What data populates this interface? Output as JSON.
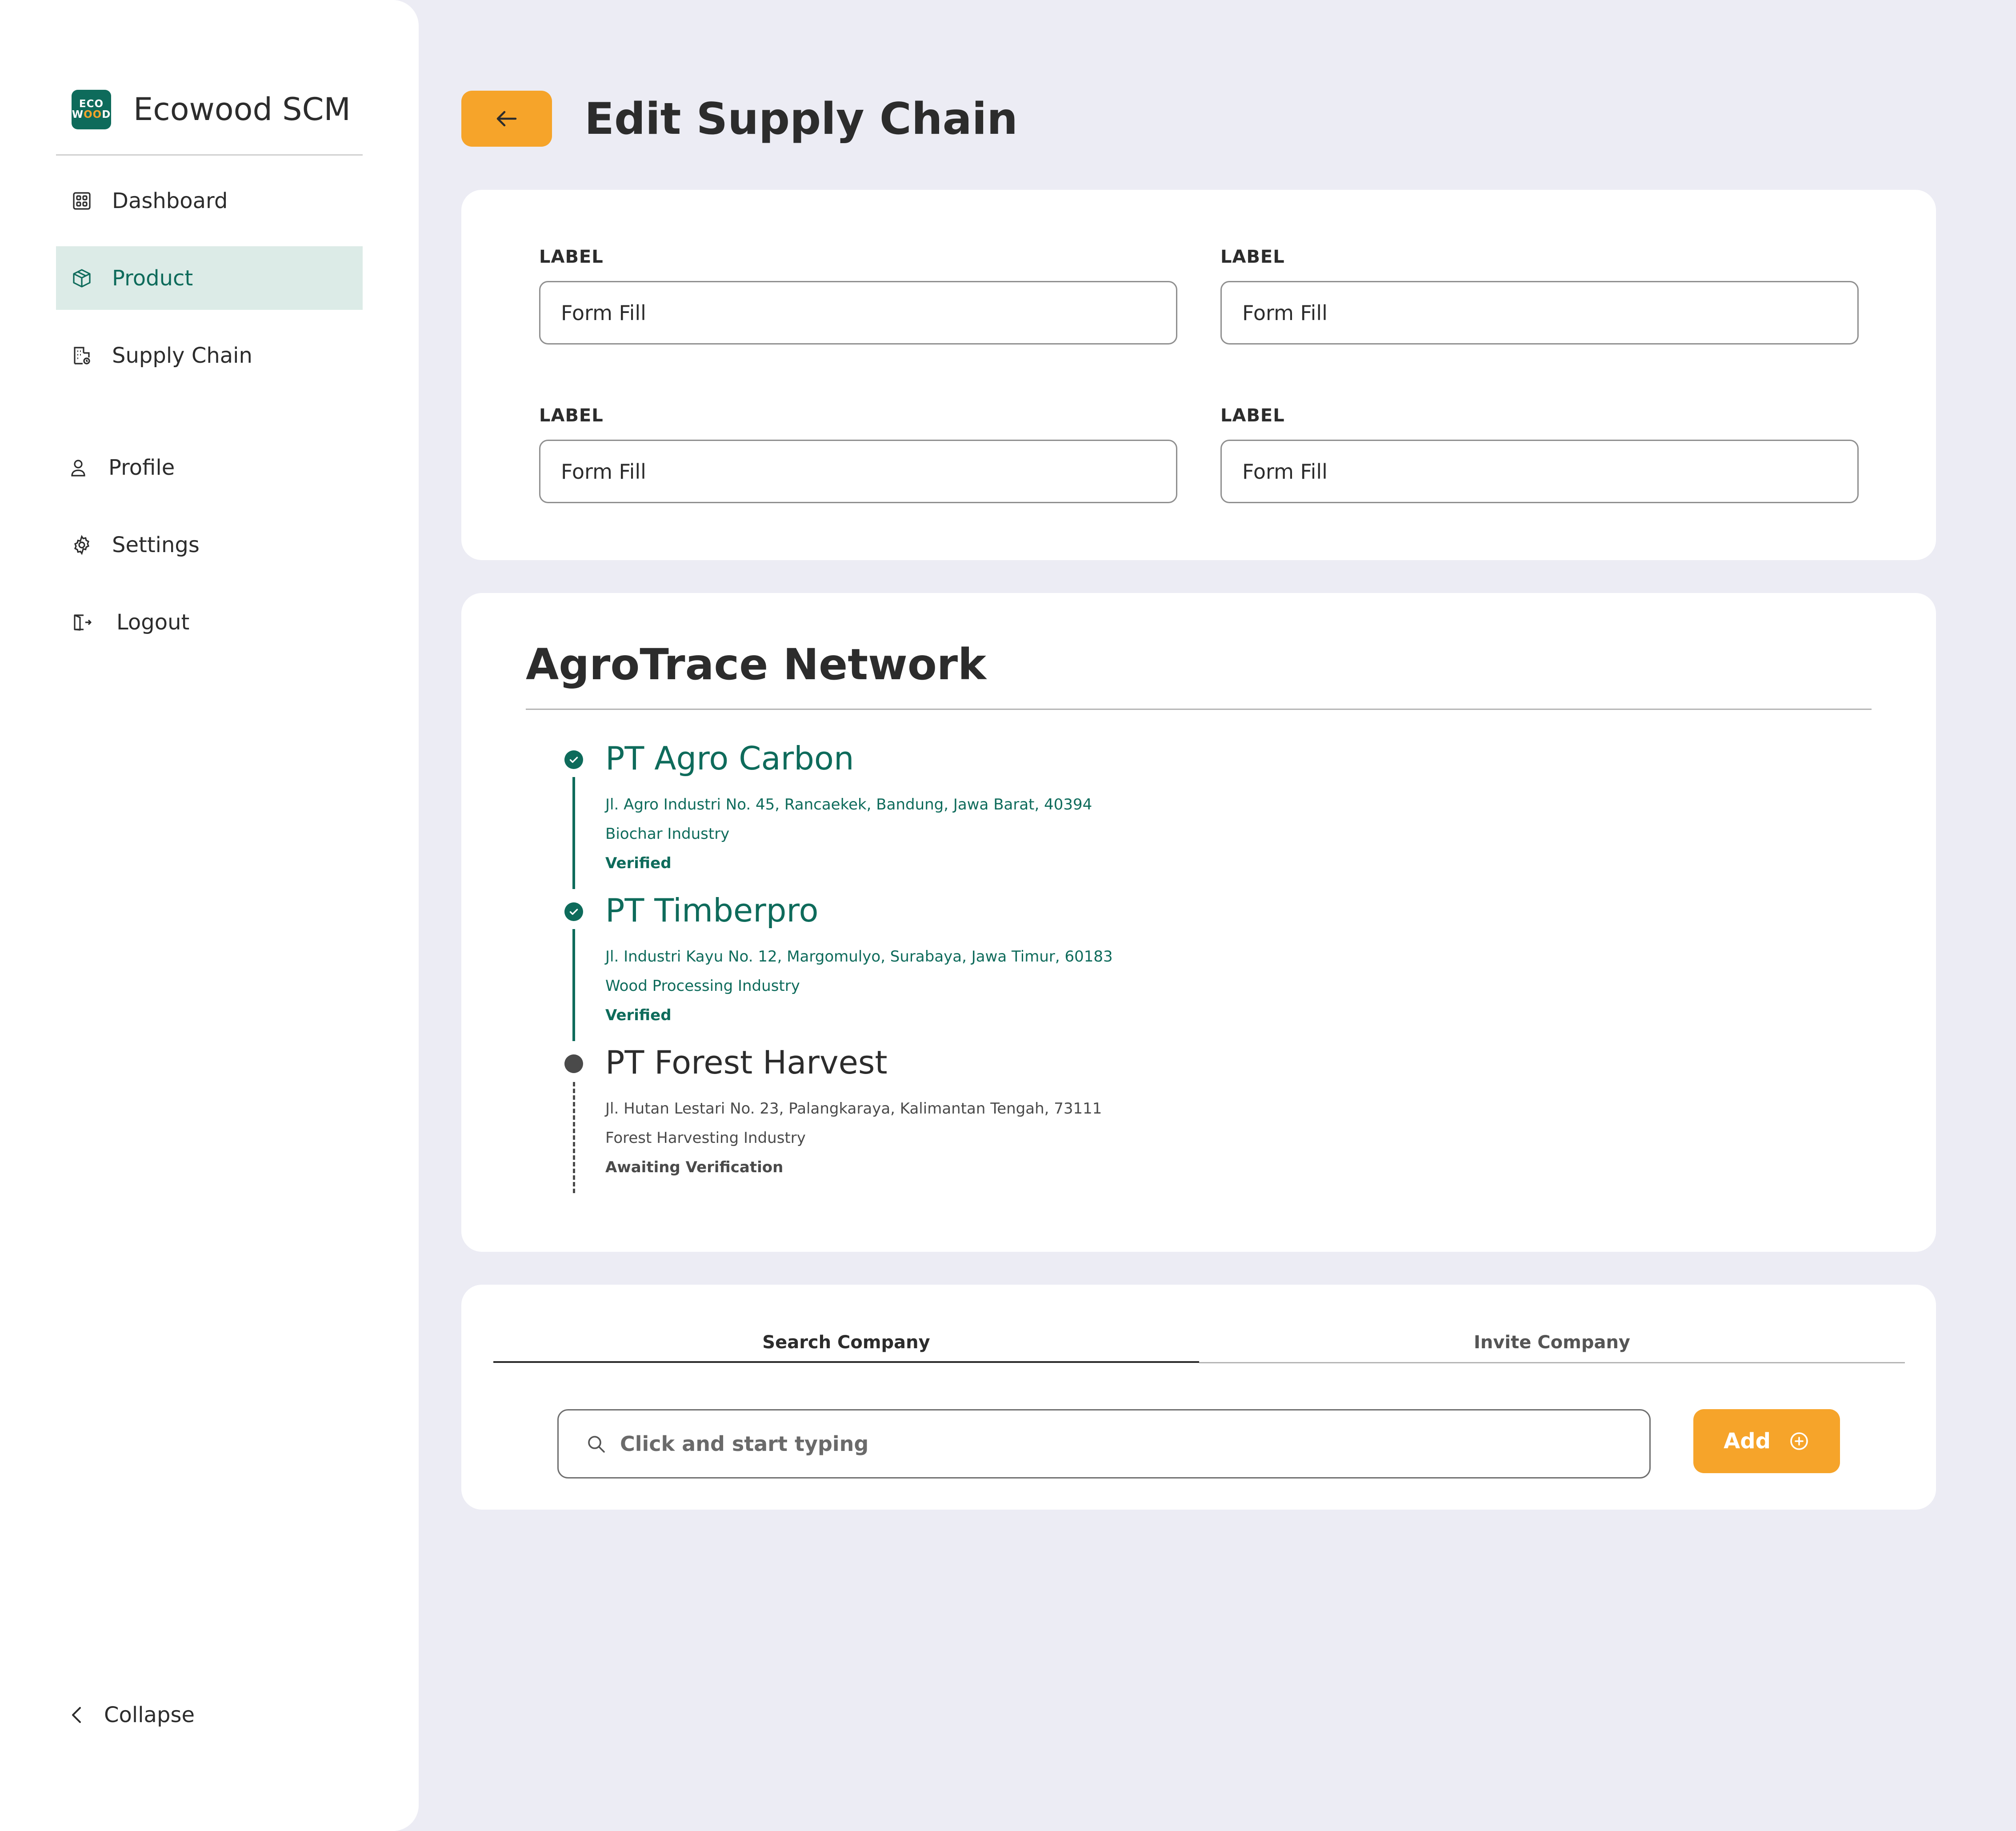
{
  "app": {
    "name": "Ecowood SCM",
    "logo_line1": "ECO",
    "logo_line2_a": "W",
    "logo_line2_b": "OO",
    "logo_line2_c": "D"
  },
  "sidebar": {
    "items": [
      {
        "label": "Dashboard",
        "icon": "grid-icon"
      },
      {
        "label": "Product",
        "icon": "box-icon",
        "active": true
      },
      {
        "label": "Supply Chain",
        "icon": "building-icon"
      },
      {
        "label": "Profile",
        "icon": "user-icon"
      },
      {
        "label": "Settings",
        "icon": "gear-icon"
      },
      {
        "label": "Logout",
        "icon": "logout-icon"
      }
    ],
    "collapse_label": "Collapse"
  },
  "header": {
    "title": "Edit Supply Chain"
  },
  "form": {
    "fields": [
      {
        "label": "LABEL",
        "value": "Form Fill"
      },
      {
        "label": "LABEL",
        "value": "Form Fill"
      },
      {
        "label": "LABEL",
        "value": "Form Fill"
      },
      {
        "label": "LABEL",
        "value": "Form Fill"
      }
    ]
  },
  "network": {
    "title": "AgroTrace Network",
    "steps": [
      {
        "name": "PT Agro Carbon",
        "address": "Jl. Agro Industri No. 45, Rancaekek, Bandung, Jawa Barat, 40394",
        "industry": "Biochar Industry",
        "status": "Verified"
      },
      {
        "name": "PT Timberpro",
        "address": "Jl. Industri Kayu No. 12, Margomulyo, Surabaya, Jawa Timur, 60183",
        "industry": "Wood Processing Industry",
        "status": "Verified"
      },
      {
        "name": "PT Forest Harvest",
        "address": "Jl. Hutan Lestari No. 23, Palangkaraya, Kalimantan Tengah, 73111",
        "industry": "Forest Harvesting Industry",
        "status": "Awaiting Verification"
      }
    ]
  },
  "search": {
    "tabs": [
      "Search Company",
      "Invite Company"
    ],
    "placeholder": "Click and start typing",
    "add_label": "Add"
  },
  "colors": {
    "accent": "#F6A42A",
    "brand": "#0E6B5B",
    "background": "#ECECF4",
    "active_nav_bg": "#DCEBE7"
  }
}
